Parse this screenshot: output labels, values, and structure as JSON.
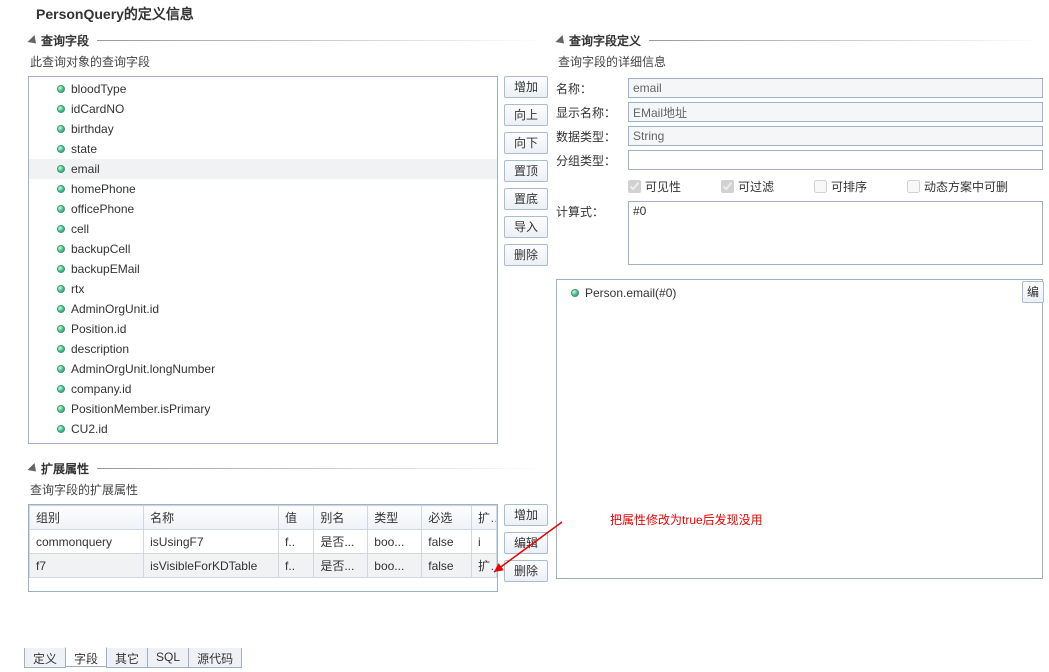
{
  "title": "PersonQuery的定义信息",
  "left": {
    "fields_section": {
      "header": "查询字段",
      "desc": "此查询对象的查询字段",
      "items": [
        "bloodType",
        "idCardNO",
        "birthday",
        "state",
        "email",
        "homePhone",
        "officePhone",
        "cell",
        "backupCell",
        "backupEMail",
        "rtx",
        "AdminOrgUnit.id",
        "Position.id",
        "description",
        "AdminOrgUnit.longNumber",
        "company.id",
        "PositionMember.isPrimary",
        "CU2.id"
      ],
      "selected_index": 4,
      "buttons": [
        "增加",
        "向上",
        "向下",
        "置顶",
        "置底",
        "导入",
        "删除"
      ]
    },
    "ext_section": {
      "header": "扩展属性",
      "desc": "查询字段的扩展属性",
      "columns": [
        "组别",
        "名称",
        "值",
        "别名",
        "类型",
        "必选",
        "扩"
      ],
      "rows": [
        {
          "group": "commonquery",
          "name": "isUsingF7",
          "value": "f..",
          "alias": "是否...",
          "type": "boo...",
          "required": "false",
          "ext": "i"
        },
        {
          "group": "f7",
          "name": "isVisibleForKDTable",
          "value": "f..",
          "alias": "是否...",
          "type": "boo...",
          "required": "false",
          "ext": "扩"
        }
      ],
      "selected_row": 1,
      "buttons": [
        "增加",
        "编辑",
        "删除"
      ]
    }
  },
  "right": {
    "header": "查询字段定义",
    "desc": "查询字段的详细信息",
    "form": {
      "name_label": "名称：",
      "name_value": "email",
      "disp_label": "显示名称：",
      "disp_value": "EMail地址",
      "type_label": "数据类型：",
      "type_value": "String",
      "group_label": "分组类型：",
      "group_value": "",
      "checks": [
        {
          "label": "可见性",
          "checked": true
        },
        {
          "label": "可过滤",
          "checked": true
        },
        {
          "label": "可排序",
          "checked": false
        },
        {
          "label": "动态方案中可删",
          "checked": false
        }
      ],
      "expr_label": "计算式：",
      "expr_value": "#0"
    },
    "tree_item": "Person.email(#0)",
    "edit_side_btn": "编"
  },
  "annotation": "把属性修改为true后发现没用",
  "tabs": [
    "定义",
    "字段",
    "其它",
    "SQL",
    "源代码"
  ],
  "active_tab": 1
}
